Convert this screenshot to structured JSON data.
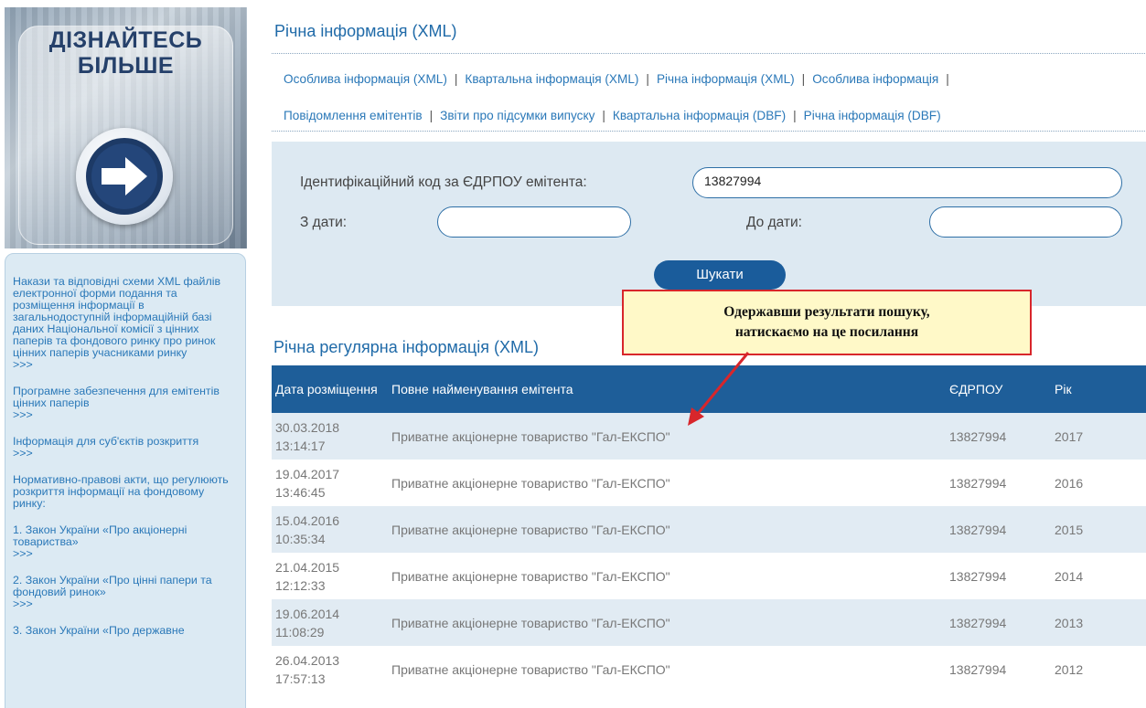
{
  "banner": {
    "text": "ДІЗНАЙТЕСЬ\nБІЛЬШЕ",
    "icon": "arrow-right-icon"
  },
  "sidebar": {
    "items": [
      {
        "text": "Накази та відповідні схеми XML файлів електронної форми подання та розміщення інформації в загальнодоступній інформаційній базі даних Національної комісії з цінних паперів та фондового ринку про ринок цінних паперів учасниками ринку",
        "more": ">>>"
      },
      {
        "text": "Програмне забезпечення для емітентів цінних паперів",
        "more": ">>>"
      },
      {
        "text": "Інформація для суб'єктів розкриття",
        "more": ">>>"
      },
      {
        "text": "Нормативно-правові акти, що регулюють розкриття інформації на фондовому ринку:",
        "more": ""
      },
      {
        "text": "1. Закон України «Про акціонерні товариства»",
        "more": ">>>"
      },
      {
        "text": "2. Закон України «Про цінні папери та фондовий ринок»",
        "more": ">>>"
      },
      {
        "text": "3. Закон України «Про державне",
        "more": ""
      }
    ]
  },
  "page": {
    "title": "Річна інформація (XML)"
  },
  "nav": {
    "separator": "|",
    "row1": [
      "Особлива інформація (XML)",
      "Квартальна інформація (XML)",
      "Річна інформація (XML)",
      "Особлива інформація"
    ],
    "row2": [
      "Повідомлення емітентів",
      "Звіти про підсумки випуску",
      "Квартальна інформація (DBF)",
      "Річна інформація (DBF)"
    ]
  },
  "search": {
    "code_label": "Ідентифікаційний код за ЄДРПОУ емітента:",
    "code_value": "13827994",
    "from_label": "З дати:",
    "from_value": "",
    "to_label": "До дати:",
    "to_value": "",
    "button": "Шукати"
  },
  "results": {
    "title": "Річна регулярна інформація (XML)",
    "headers": [
      "Дата розміщення",
      "Повне найменування емітента",
      "ЄДРПОУ",
      "Рік"
    ],
    "rows": [
      {
        "date": "30.03.2018",
        "time": "13:14:17",
        "name": "Приватне акціонерне товариство \"Гал-ЕКСПО\"",
        "code": "13827994",
        "year": "2017"
      },
      {
        "date": "19.04.2017",
        "time": "13:46:45",
        "name": "Приватне акціонерне товариство \"Гал-ЕКСПО\"",
        "code": "13827994",
        "year": "2016"
      },
      {
        "date": "15.04.2016",
        "time": "10:35:34",
        "name": "Приватне акціонерне товариство \"Гал-ЕКСПО\"",
        "code": "13827994",
        "year": "2015"
      },
      {
        "date": "21.04.2015",
        "time": "12:12:33",
        "name": "Приватне акціонерне товариство \"Гал-ЕКСПО\"",
        "code": "13827994",
        "year": "2014"
      },
      {
        "date": "19.06.2014",
        "time": "11:08:29",
        "name": "Приватне акціонерне товариство \"Гал-ЕКСПО\"",
        "code": "13827994",
        "year": "2013"
      },
      {
        "date": "26.04.2013",
        "time": "17:57:13",
        "name": "Приватне акціонерне товариство \"Гал-ЕКСПО\"",
        "code": "13827994",
        "year": "2012"
      }
    ]
  },
  "callout": {
    "line1": "Одержавши результати пошуку,",
    "line2": "натискаємо на це посилання"
  },
  "colors": {
    "header_blue": "#1e5e99",
    "link_blue": "#2a78b8",
    "callout_border": "#d8262b",
    "callout_bg": "#fff9c8"
  }
}
